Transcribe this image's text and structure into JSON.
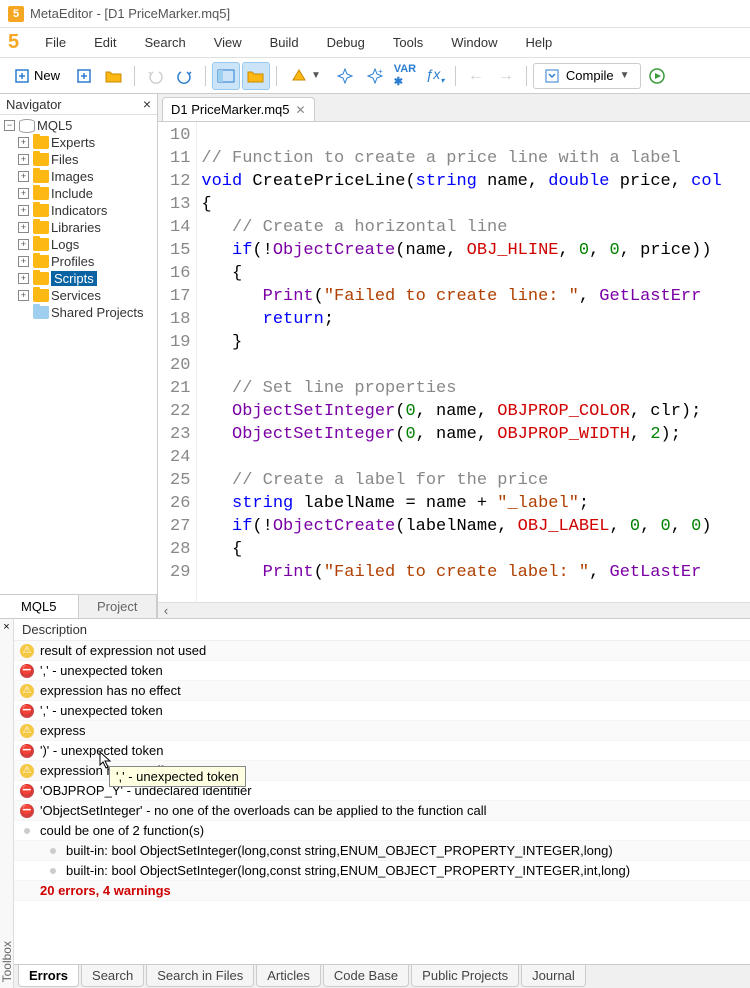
{
  "window": {
    "title": "MetaEditor - [D1 PriceMarker.mq5]"
  },
  "menu": [
    "File",
    "Edit",
    "Search",
    "View",
    "Build",
    "Debug",
    "Tools",
    "Window",
    "Help"
  ],
  "toolbar": {
    "new": "New",
    "compile": "Compile"
  },
  "navigator": {
    "title": "Navigator",
    "root": "MQL5",
    "items": [
      {
        "label": "Experts"
      },
      {
        "label": "Files"
      },
      {
        "label": "Images"
      },
      {
        "label": "Include"
      },
      {
        "label": "Indicators"
      },
      {
        "label": "Libraries"
      },
      {
        "label": "Logs"
      },
      {
        "label": "Profiles"
      },
      {
        "label": "Scripts",
        "selected": true
      },
      {
        "label": "Services"
      },
      {
        "label": "Shared Projects",
        "blue": true,
        "expandable": false
      }
    ],
    "tabs": [
      "MQL5",
      "Project"
    ]
  },
  "editor": {
    "tab": "D1 PriceMarker.mq5",
    "lines_start": 10,
    "code": [
      {
        "n": 10,
        "t": ""
      },
      {
        "n": 11,
        "t": "<com>// Function to create a price line with a label</com>"
      },
      {
        "n": 12,
        "t": "<kw>void</kw> CreatePriceLine(<kw>string</kw> name, <kw>double</kw> price, <kw>col</kw>"
      },
      {
        "n": 13,
        "t": "{"
      },
      {
        "n": 14,
        "t": "   <com>// Create a horizontal line</com>"
      },
      {
        "n": 15,
        "t": "   <kw>if</kw>(!<fn>ObjectCreate</fn>(name, <red>OBJ_HLINE</red>, <num>0</num>, <num>0</num>, price))"
      },
      {
        "n": 16,
        "t": "   {"
      },
      {
        "n": 17,
        "t": "      <fn>Print</fn>(<str>\"Failed to create line: \"</str>, <fn>GetLastErr</fn>"
      },
      {
        "n": 18,
        "t": "      <kw>return</kw>;"
      },
      {
        "n": 19,
        "t": "   }"
      },
      {
        "n": 20,
        "t": ""
      },
      {
        "n": 21,
        "t": "   <com>// Set line properties</com>"
      },
      {
        "n": 22,
        "t": "   <fn>ObjectSetInteger</fn>(<num>0</num>, name, <red>OBJPROP_COLOR</red>, clr);"
      },
      {
        "n": 23,
        "t": "   <fn>ObjectSetInteger</fn>(<num>0</num>, name, <red>OBJPROP_WIDTH</red>, <num>2</num>);"
      },
      {
        "n": 24,
        "t": ""
      },
      {
        "n": 25,
        "t": "   <com>// Create a label for the price</com>"
      },
      {
        "n": 26,
        "t": "   <kw>string</kw> labelName = name + <str>\"_label\"</str>;"
      },
      {
        "n": 27,
        "t": "   <kw>if</kw>(!<fn>ObjectCreate</fn>(labelName, <red>OBJ_LABEL</red>, <num>0</num>, <num>0</num>, <num>0</num>)"
      },
      {
        "n": 28,
        "t": "   {"
      },
      {
        "n": 29,
        "t": "      <fn>Print</fn>(<str>\"Failed to create label: \"</str>, <fn>GetLastEr</fn>"
      }
    ]
  },
  "toolbox": {
    "title": "Toolbox",
    "header": "Description",
    "rows": [
      {
        "type": "warn",
        "text": "result of expression not used"
      },
      {
        "type": "err",
        "text": "',' - unexpected token"
      },
      {
        "type": "warn",
        "text": "expression has no effect"
      },
      {
        "type": "err",
        "text": "',' - unexpected token"
      },
      {
        "type": "warn",
        "text": "express"
      },
      {
        "type": "err",
        "text": "')' - unexpected token"
      },
      {
        "type": "warn",
        "text": "expression has no effect"
      },
      {
        "type": "err",
        "text": "'OBJPROP_Y' - undeclared identifier"
      },
      {
        "type": "err",
        "text": "'ObjectSetInteger' - no one of the overloads can be applied to the function call"
      },
      {
        "type": "info",
        "text": "could be one of 2 function(s)"
      },
      {
        "type": "info",
        "sub": true,
        "text": "built-in: bool ObjectSetInteger(long,const string,ENUM_OBJECT_PROPERTY_INTEGER,long)"
      },
      {
        "type": "info",
        "sub": true,
        "text": "built-in: bool ObjectSetInteger(long,const string,ENUM_OBJECT_PROPERTY_INTEGER,int,long)"
      },
      {
        "type": "summary",
        "text": "20 errors, 4 warnings"
      }
    ],
    "tooltip": "',' - unexpected token",
    "tabs": [
      "Errors",
      "Search",
      "Search in Files",
      "Articles",
      "Code Base",
      "Public Projects",
      "Journal"
    ]
  }
}
